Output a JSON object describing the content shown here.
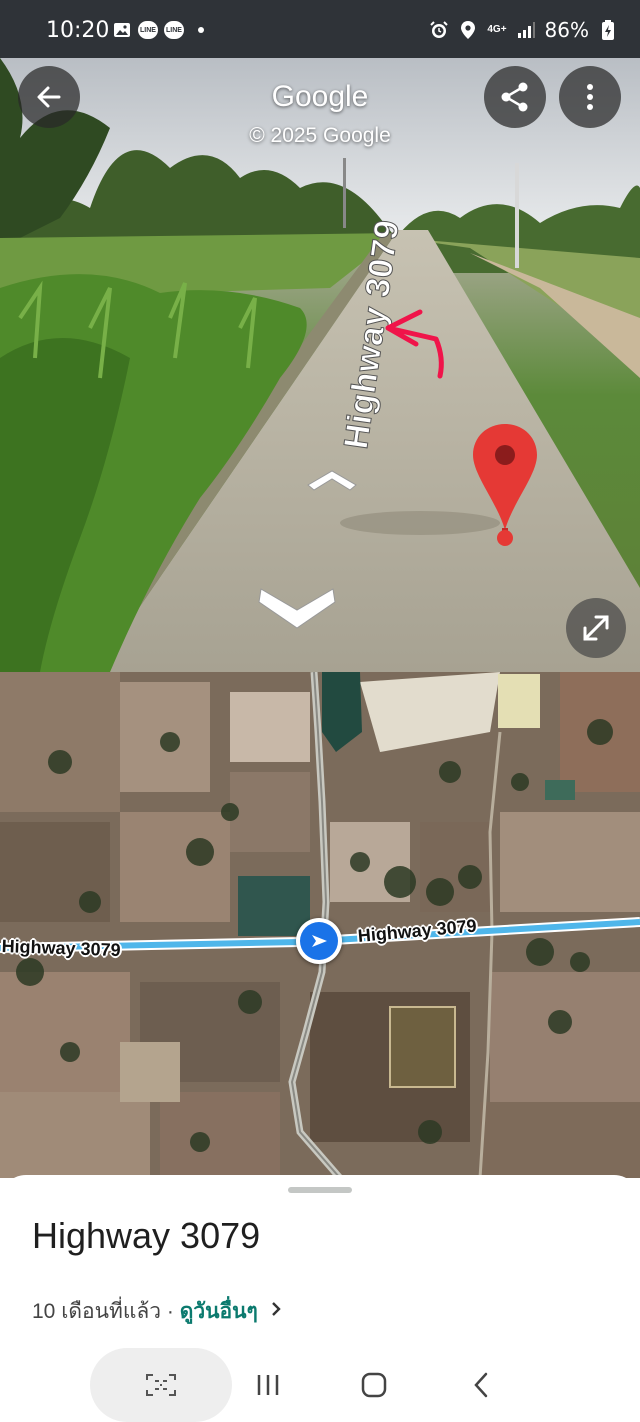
{
  "status_bar": {
    "time": "10:20",
    "network_label": "4G+",
    "battery": "86%",
    "icons_left": [
      "gallery-icon",
      "line-app-icon",
      "line-app-icon",
      "dot-icon"
    ],
    "line_text": "LINE",
    "icons_right": [
      "alarm-icon",
      "location-icon",
      "network-icon",
      "signal-icon",
      "battery-charging-icon"
    ]
  },
  "street_view": {
    "brand": "Google",
    "copyright": "© 2025 Google",
    "road_label": "Highway 3079",
    "buttons": [
      "back-arrow-icon",
      "share-icon",
      "more-vert-icon",
      "expand-icon"
    ],
    "pin_color": "#e53935",
    "annotation_color": "#f0144a"
  },
  "map": {
    "road_label_left": "Highway 3079",
    "road_label_right": "Highway 3079",
    "route_color": "#4fb6ea",
    "marker_color": "#1a73e8"
  },
  "place": {
    "title": "Highway 3079",
    "age": "10 เดือนที่แล้ว",
    "separator": " · ",
    "link": "ดูวันอื่นๆ"
  },
  "nav": {
    "buttons": [
      "screenshot-icon",
      "recents-icon",
      "home-icon",
      "back-icon"
    ]
  }
}
